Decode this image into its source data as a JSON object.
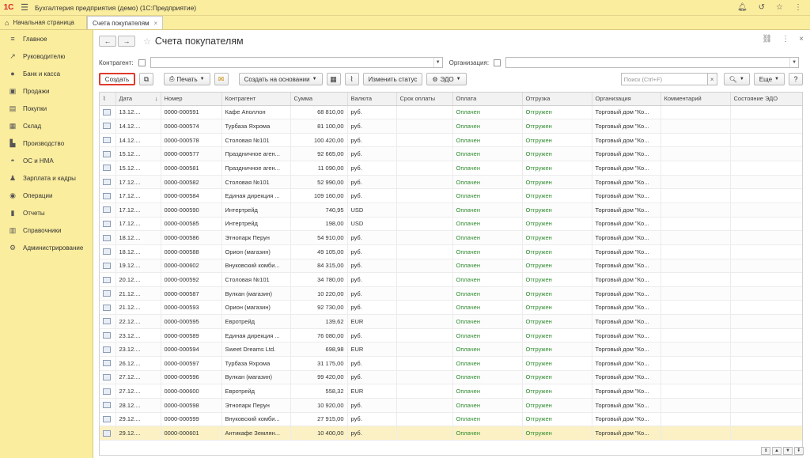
{
  "app": {
    "title": "Бухгалтерия предприятия (демо)  (1С:Предприятие)",
    "logo": "1С"
  },
  "tabs": [
    {
      "label": "Начальная страница"
    },
    {
      "label": "Счета покупателям"
    }
  ],
  "sidebar": {
    "items": [
      {
        "label": "Главное",
        "icon": "menu-icon"
      },
      {
        "label": "Руководителю",
        "icon": "chart-line-icon"
      },
      {
        "label": "Банк и касса",
        "icon": "coins-icon"
      },
      {
        "label": "Продажи",
        "icon": "cart-icon"
      },
      {
        "label": "Покупки",
        "icon": "basket-icon"
      },
      {
        "label": "Склад",
        "icon": "warehouse-icon"
      },
      {
        "label": "Производство",
        "icon": "factory-icon"
      },
      {
        "label": "ОС и НМА",
        "icon": "car-icon"
      },
      {
        "label": "Зарплата и кадры",
        "icon": "people-icon"
      },
      {
        "label": "Операции",
        "icon": "operations-icon"
      },
      {
        "label": "Отчеты",
        "icon": "reports-icon"
      },
      {
        "label": "Справочники",
        "icon": "books-icon"
      },
      {
        "label": "Администрирование",
        "icon": "gear-icon"
      }
    ]
  },
  "form": {
    "title": "Счета покупателям"
  },
  "filters": {
    "kontragent_label": "Контрагент:",
    "org_label": "Организация:"
  },
  "toolbar": {
    "create": "Создать",
    "print": "Печать",
    "create_based": "Создать на основании",
    "change_status": "Изменить статус",
    "edo": "ЭДО",
    "search_placeholder": "Поиск (Ctrl+F)",
    "more": "Еще",
    "help": "?"
  },
  "columns": [
    "Дата",
    "Номер",
    "Контрагент",
    "Сумма",
    "Валюта",
    "Срок оплаты",
    "Оплата",
    "Отгрузка",
    "Организация",
    "Комментарий",
    "Состояние ЭДО"
  ],
  "rows": [
    {
      "date": "13.12....",
      "num": "0000-000591",
      "kontr": "Кафе Аполлон",
      "sum": "68 810,00",
      "cur": "руб.",
      "pay": "Оплачен",
      "ship": "Отгружен",
      "org": "Торговый дом \"Ко..."
    },
    {
      "date": "14.12....",
      "num": "0000-000574",
      "kontr": "Турбаза Яхрома",
      "sum": "81 100,00",
      "cur": "руб.",
      "pay": "Оплачен",
      "ship": "Отгружен",
      "org": "Торговый дом \"Ко..."
    },
    {
      "date": "14.12....",
      "num": "0000-000578",
      "kontr": "Столовая №101",
      "sum": "100 420,00",
      "cur": "руб.",
      "pay": "Оплачен",
      "ship": "Отгружен",
      "org": "Торговый дом \"Ко..."
    },
    {
      "date": "15.12....",
      "num": "0000-000577",
      "kontr": "Праздничное аген...",
      "sum": "92 665,00",
      "cur": "руб.",
      "pay": "Оплачен",
      "ship": "Отгружен",
      "org": "Торговый дом \"Ко..."
    },
    {
      "date": "15.12....",
      "num": "0000-000581",
      "kontr": "Праздничное аген...",
      "sum": "11 090,00",
      "cur": "руб.",
      "pay": "Оплачен",
      "ship": "Отгружен",
      "org": "Торговый дом \"Ко..."
    },
    {
      "date": "17.12....",
      "num": "0000-000582",
      "kontr": "Столовая №101",
      "sum": "52 990,00",
      "cur": "руб.",
      "pay": "Оплачен",
      "ship": "Отгружен",
      "org": "Торговый дом \"Ко..."
    },
    {
      "date": "17.12....",
      "num": "0000-000584",
      "kontr": "Единая дирекция ...",
      "sum": "109 160,00",
      "cur": "руб.",
      "pay": "Оплачен",
      "ship": "Отгружен",
      "org": "Торговый дом \"Ко..."
    },
    {
      "date": "17.12....",
      "num": "0000-000590",
      "kontr": "Интертрейд",
      "sum": "740,95",
      "cur": "USD",
      "pay": "Оплачен",
      "ship": "Отгружен",
      "org": "Торговый дом \"Ко..."
    },
    {
      "date": "17.12....",
      "num": "0000-000585",
      "kontr": "Интертрейд",
      "sum": "198,00",
      "cur": "USD",
      "pay": "Оплачен",
      "ship": "Отгружен",
      "org": "Торговый дом \"Ко..."
    },
    {
      "date": "18.12....",
      "num": "0000-000586",
      "kontr": "Этнопарк Перун",
      "sum": "54 910,00",
      "cur": "руб.",
      "pay": "Оплачен",
      "ship": "Отгружен",
      "org": "Торговый дом \"Ко..."
    },
    {
      "date": "18.12....",
      "num": "0000-000588",
      "kontr": "Орион (магазин)",
      "sum": "49 105,00",
      "cur": "руб.",
      "pay": "Оплачен",
      "ship": "Отгружен",
      "org": "Торговый дом \"Ко..."
    },
    {
      "date": "19.12....",
      "num": "0000-000602",
      "kontr": "Внуковский комби...",
      "sum": "84 315,00",
      "cur": "руб.",
      "pay": "Оплачен",
      "ship": "Отгружен",
      "org": "Торговый дом \"Ко..."
    },
    {
      "date": "20.12....",
      "num": "0000-000592",
      "kontr": "Столовая №101",
      "sum": "34 780,00",
      "cur": "руб.",
      "pay": "Оплачен",
      "ship": "Отгружен",
      "org": "Торговый дом \"Ко..."
    },
    {
      "date": "21.12....",
      "num": "0000-000587",
      "kontr": "Вулкан (магазин)",
      "sum": "10 220,00",
      "cur": "руб.",
      "pay": "Оплачен",
      "ship": "Отгружен",
      "org": "Торговый дом \"Ко..."
    },
    {
      "date": "21.12....",
      "num": "0000-000593",
      "kontr": "Орион (магазин)",
      "sum": "92 730,00",
      "cur": "руб.",
      "pay": "Оплачен",
      "ship": "Отгружен",
      "org": "Торговый дом \"Ко..."
    },
    {
      "date": "22.12....",
      "num": "0000-000595",
      "kontr": "Евротрейд",
      "sum": "139,62",
      "cur": "EUR",
      "pay": "Оплачен",
      "ship": "Отгружен",
      "org": "Торговый дом \"Ко..."
    },
    {
      "date": "23.12....",
      "num": "0000-000589",
      "kontr": "Единая дирекция ...",
      "sum": "76 080,00",
      "cur": "руб.",
      "pay": "Оплачен",
      "ship": "Отгружен",
      "org": "Торговый дом \"Ко..."
    },
    {
      "date": "23.12....",
      "num": "0000-000594",
      "kontr": "Sweet Dreams Ltd.",
      "sum": "698,98",
      "cur": "EUR",
      "pay": "Оплачен",
      "ship": "Отгружен",
      "org": "Торговый дом \"Ко..."
    },
    {
      "date": "26.12....",
      "num": "0000-000597",
      "kontr": "Турбаза Яхрома",
      "sum": "31 175,00",
      "cur": "руб.",
      "pay": "Оплачен",
      "ship": "Отгружен",
      "org": "Торговый дом \"Ко..."
    },
    {
      "date": "27.12....",
      "num": "0000-000596",
      "kontr": "Вулкан (магазин)",
      "sum": "99 420,00",
      "cur": "руб.",
      "pay": "Оплачен",
      "ship": "Отгружен",
      "org": "Торговый дом \"Ко..."
    },
    {
      "date": "27.12....",
      "num": "0000-000600",
      "kontr": "Евротрейд",
      "sum": "558,32",
      "cur": "EUR",
      "pay": "Оплачен",
      "ship": "Отгружен",
      "org": "Торговый дом \"Ко..."
    },
    {
      "date": "28.12....",
      "num": "0000-000598",
      "kontr": "Этнопарк Перун",
      "sum": "10 920,00",
      "cur": "руб.",
      "pay": "Оплачен",
      "ship": "Отгружен",
      "org": "Торговый дом \"Ко..."
    },
    {
      "date": "29.12....",
      "num": "0000-000599",
      "kontr": "Внуковский комби...",
      "sum": "27 915,00",
      "cur": "руб.",
      "pay": "Оплачен",
      "ship": "Отгружен",
      "org": "Торговый дом \"Ко..."
    },
    {
      "date": "29.12....",
      "num": "0000-000601",
      "kontr": "Антикафе Землян...",
      "sum": "10 400,00",
      "cur": "руб.",
      "pay": "Оплачен",
      "ship": "Отгружен",
      "org": "Торговый дом \"Ко..."
    }
  ],
  "colors": {
    "accent_yellow": "#fbed9e",
    "create_border": "#e03a2d",
    "paid_green": "#2c8a2c",
    "selected_row": "#fbf1c4"
  }
}
